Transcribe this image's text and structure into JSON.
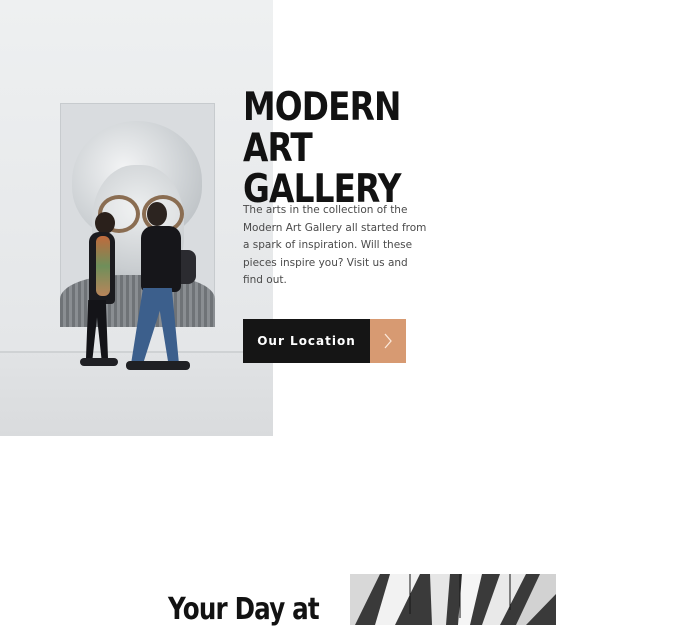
{
  "hero": {
    "title_line1": "MODERN ART",
    "title_line2": "GALLERY",
    "description": "The arts in the collection of the Modern Art Gallery all started from a spark of inspiration. Will these pieces inspire you? Visit us and find out.",
    "cta_label": "Our Location",
    "cta_icon": "chevron-right-icon",
    "accent_color": "#d79a72",
    "button_color": "#151515"
  },
  "section": {
    "title": "Your Day at"
  }
}
